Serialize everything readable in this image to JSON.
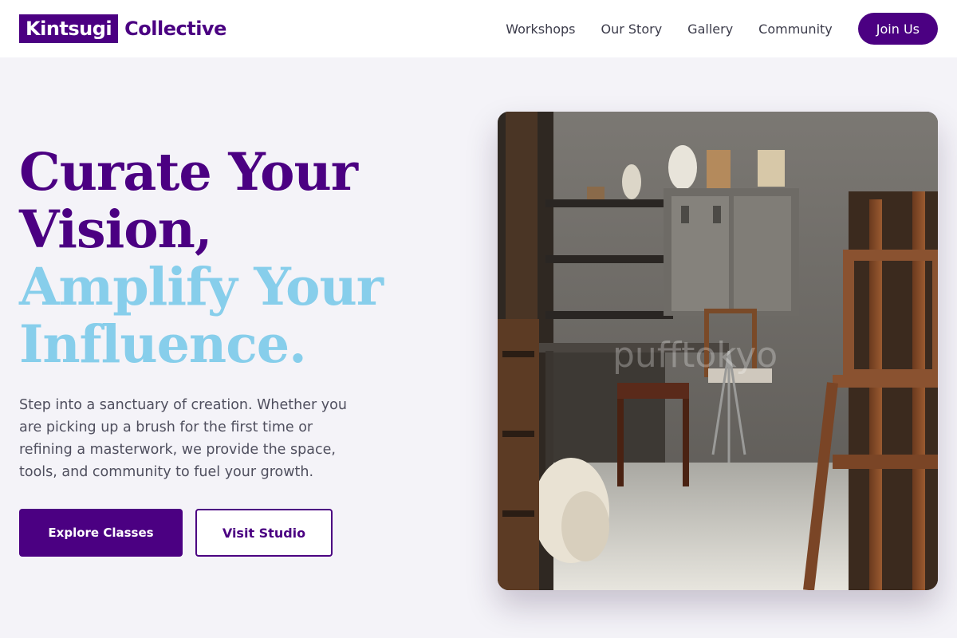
{
  "header": {
    "logo_box": "Kintsugi",
    "logo_text": "Collective",
    "nav": [
      "Workshops",
      "Our Story",
      "Gallery",
      "Community"
    ],
    "cta": "Join Us"
  },
  "hero": {
    "headline_line1": "Curate Your",
    "headline_line2": "Vision,",
    "headline_line3": "Amplify Your",
    "headline_line4": "Influence.",
    "lead": "Step into a sanctuary of creation. Whether you are picking up a brush for the first time or refining a masterwork, we provide the space, tools, and community to fuel your growth.",
    "primary_button": "Explore Classes",
    "secondary_button": "Visit Studio",
    "image_watermark": "pufftokyo"
  },
  "colors": {
    "brand": "#4b0082",
    "accent": "#87ceeb",
    "background": "#f4f3f8"
  }
}
